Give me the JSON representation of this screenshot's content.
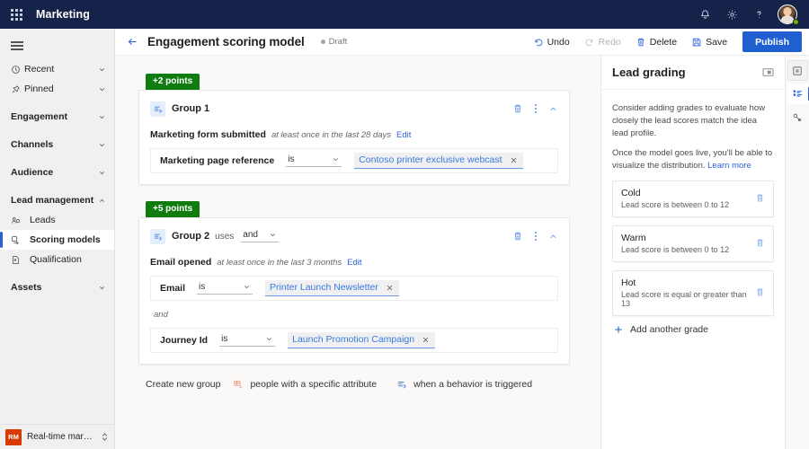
{
  "suitebar": {
    "app_launcher": "app-launcher",
    "title": "Marketing",
    "notification_icon": "bell-icon",
    "settings_icon": "gear-icon",
    "help_icon": "question-icon",
    "avatar": "user-avatar"
  },
  "sidenav": {
    "hamburger": "menu-icon",
    "items": [
      {
        "label": "Recent",
        "icon": "clock-icon",
        "type": "expandable",
        "chevron": "down"
      },
      {
        "label": "Pinned",
        "icon": "pin-icon",
        "type": "expandable",
        "chevron": "down"
      },
      {
        "label": "Engagement",
        "icon": "",
        "type": "group",
        "chevron": "down"
      },
      {
        "label": "Channels",
        "icon": "",
        "type": "group",
        "chevron": "down"
      },
      {
        "label": "Audience",
        "icon": "",
        "type": "group",
        "chevron": "down"
      },
      {
        "label": "Lead management",
        "icon": "",
        "type": "group",
        "chevron": "up"
      },
      {
        "label": "Leads",
        "icon": "leads-icon",
        "type": "child"
      },
      {
        "label": "Scoring models",
        "icon": "scoring-icon",
        "type": "child",
        "selected": true
      },
      {
        "label": "Qualification",
        "icon": "qualification-icon",
        "type": "child"
      },
      {
        "label": "Assets",
        "icon": "",
        "type": "group",
        "chevron": "down"
      }
    ],
    "footer": {
      "badge": "RM",
      "name": "Real-time marketi...",
      "switcher_icon": "chevron-updown-icon"
    }
  },
  "commandbar": {
    "back_icon": "back-arrow-icon",
    "title": "Engagement scoring model",
    "status": "Draft",
    "undo": {
      "label": "Undo",
      "icon": "undo-icon",
      "disabled": false
    },
    "redo": {
      "label": "Redo",
      "icon": "redo-icon",
      "disabled": true
    },
    "delete": {
      "label": "Delete",
      "icon": "trash-icon",
      "disabled": false
    },
    "save": {
      "label": "Save",
      "icon": "save-icon",
      "disabled": false
    },
    "publish": "Publish"
  },
  "canvas": {
    "groups": [
      {
        "points_badge": "+2 points",
        "name": "Group 1",
        "uses_label": "",
        "logic_operator": "",
        "trigger_name": "Marketing form submitted",
        "trigger_frequency": "at least once in the last 28 days",
        "edit_label": "Edit",
        "conditions": [
          {
            "label": "Marketing page reference",
            "operator": "is",
            "value": "Contoso printer exclusive webcast"
          }
        ],
        "separators": []
      },
      {
        "points_badge": "+5 points",
        "name": "Group 2",
        "uses_label": "uses",
        "logic_operator": "and",
        "trigger_name": "Email opened",
        "trigger_frequency": "at least once in the last 3 months",
        "edit_label": "Edit",
        "conditions": [
          {
            "label": "Email",
            "operator": "is",
            "value": "Printer Launch Newsletter"
          },
          {
            "label": "Journey Id",
            "operator": "is",
            "value": "Launch Promotion Campaign"
          }
        ],
        "separators": [
          "and"
        ]
      }
    ],
    "create_row": {
      "label": "Create new group",
      "options": [
        {
          "text": "people with a specific attribute",
          "icon": "attribute-icon"
        },
        {
          "text": "when a behavior is triggered",
          "icon": "behavior-icon"
        }
      ]
    }
  },
  "rightpanel": {
    "title": "Lead grading",
    "collapse_icon": "collapse-panel-icon",
    "paragraph1": "Consider adding grades to evaluate how closely the lead scores match the idea lead profile.",
    "paragraph2": "Once the model goes live, you'll be able to visualize the distribution.",
    "learn_more": "Learn more",
    "grades": [
      {
        "name": "Cold",
        "description": "Lead score is between 0 to 12"
      },
      {
        "name": "Warm",
        "description": "Lead score is between 0 to 12"
      },
      {
        "name": "Hot",
        "description": "Lead score is equal or greater than 13"
      }
    ],
    "add_grade": "Add another grade"
  },
  "rail": {
    "buttons": [
      {
        "name": "properties-icon",
        "active": false
      },
      {
        "name": "lead-grading-icon",
        "active": true
      },
      {
        "name": "settings-tools-icon",
        "active": false
      }
    ]
  },
  "colors": {
    "suitebar_bg": "#15224a",
    "accent_blue": "#2b5fd9",
    "publish_blue": "#1f5fd0",
    "points_green": "#107c10",
    "env_orange": "#d83b01"
  }
}
